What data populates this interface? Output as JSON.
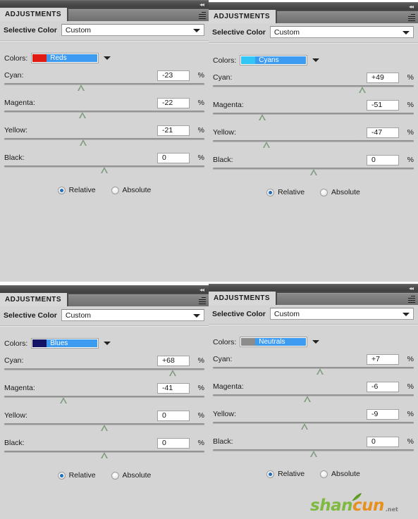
{
  "app": {
    "panel_tab_label": "ADJUSTMENTS",
    "panel_title": "Selective Color",
    "preset_value": "Custom",
    "colors_label": "Colors:",
    "percent_symbol": "%",
    "relative_label": "Relative",
    "absolute_label": "Absolute",
    "collapse_icon": "collapse-to-icons",
    "menu_icon": "panel-menu-icon"
  },
  "colors": {
    "accent_blue": "#3d9bf0",
    "panel_bg": "#d4d4d4",
    "tab_bg": "#d8d8d8",
    "dock_bar": "#4c4c4c",
    "radio_dot": "#1f6fbb",
    "slider_thumb": "#7f9c7f"
  },
  "watermark": {
    "part1": "shan",
    "part2": "cun",
    "suffix": ".net",
    "color1": "#7fb93f",
    "color2": "#e8901e"
  },
  "panels": [
    {
      "id": "panel-reds",
      "tab_label": "ADJUSTMENTS",
      "title": "Selective Color",
      "preset": "Custom",
      "colors_label": "Colors:",
      "color_channel": "Reds",
      "swatch_color": "#e01b14",
      "sliders": [
        {
          "name": "Cyan:",
          "value": "-23",
          "percent": "%",
          "position": 38.5
        },
        {
          "name": "Magenta:",
          "value": "-22",
          "percent": "%",
          "position": 39.0
        },
        {
          "name": "Yellow:",
          "value": "-21",
          "percent": "%",
          "position": 39.5
        },
        {
          "name": "Black:",
          "value": "0",
          "percent": "%",
          "position": 50.0
        }
      ],
      "mode": {
        "relative": "Relative",
        "absolute": "Absolute",
        "selected": "Relative"
      }
    },
    {
      "id": "panel-cyans",
      "tab_label": "ADJUSTMENTS",
      "title": "Selective Color",
      "preset": "Custom",
      "colors_label": "Colors:",
      "color_channel": "Cyans",
      "swatch_color": "#33c6f4",
      "sliders": [
        {
          "name": "Cyan:",
          "value": "+49",
          "percent": "%",
          "position": 74.5
        },
        {
          "name": "Magenta:",
          "value": "-51",
          "percent": "%",
          "position": 24.5
        },
        {
          "name": "Yellow:",
          "value": "-47",
          "percent": "%",
          "position": 26.5
        },
        {
          "name": "Black:",
          "value": "0",
          "percent": "%",
          "position": 50.0
        }
      ],
      "mode": {
        "relative": "Relative",
        "absolute": "Absolute",
        "selected": "Relative"
      }
    },
    {
      "id": "panel-blues",
      "tab_label": "ADJUSTMENTS",
      "title": "Selective Color",
      "preset": "Custom",
      "colors_label": "Colors:",
      "color_channel": "Blues",
      "swatch_color": "#141466",
      "sliders": [
        {
          "name": "Cyan:",
          "value": "+68",
          "percent": "%",
          "position": 84.0
        },
        {
          "name": "Magenta:",
          "value": "-41",
          "percent": "%",
          "position": 29.5
        },
        {
          "name": "Yellow:",
          "value": "0",
          "percent": "%",
          "position": 50.0
        },
        {
          "name": "Black:",
          "value": "0",
          "percent": "%",
          "position": 50.0
        }
      ],
      "mode": {
        "relative": "Relative",
        "absolute": "Absolute",
        "selected": "Relative"
      }
    },
    {
      "id": "panel-neutrals",
      "tab_label": "ADJUSTMENTS",
      "title": "Selective Color",
      "preset": "Custom",
      "colors_label": "Colors:",
      "color_channel": "Neutrals",
      "swatch_color": "#8c8c8c",
      "sliders": [
        {
          "name": "Cyan:",
          "value": "+7",
          "percent": "%",
          "position": 53.5
        },
        {
          "name": "Magenta:",
          "value": "-6",
          "percent": "%",
          "position": 47.0
        },
        {
          "name": "Yellow:",
          "value": "-9",
          "percent": "%",
          "position": 45.5
        },
        {
          "name": "Black:",
          "value": "0",
          "percent": "%",
          "position": 50.0
        }
      ],
      "mode": {
        "relative": "Relative",
        "absolute": "Absolute",
        "selected": "Relative"
      }
    }
  ]
}
